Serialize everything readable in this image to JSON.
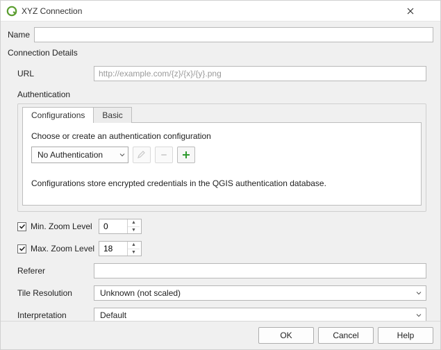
{
  "window": {
    "title": "XYZ Connection"
  },
  "name": {
    "label": "Name",
    "value": ""
  },
  "details": {
    "title": "Connection Details",
    "url_label": "URL",
    "url_value": "",
    "url_placeholder": "http://example.com/{z}/{x}/{y}.png",
    "auth": {
      "title": "Authentication",
      "tabs": {
        "configurations": "Configurations",
        "basic": "Basic"
      },
      "hint": "Choose or create an authentication configuration",
      "selected": "No Authentication",
      "note": "Configurations store encrypted credentials in the QGIS authentication database."
    },
    "min_zoom": {
      "label": "Min. Zoom Level",
      "checked": true,
      "value": "0"
    },
    "max_zoom": {
      "label": "Max. Zoom Level",
      "checked": true,
      "value": "18"
    },
    "referer": {
      "label": "Referer",
      "value": ""
    },
    "tile_res": {
      "label": "Tile Resolution",
      "value": "Unknown (not scaled)"
    },
    "interpretation": {
      "label": "Interpretation",
      "value": "Default"
    }
  },
  "buttons": {
    "ok": "OK",
    "cancel": "Cancel",
    "help": "Help"
  }
}
